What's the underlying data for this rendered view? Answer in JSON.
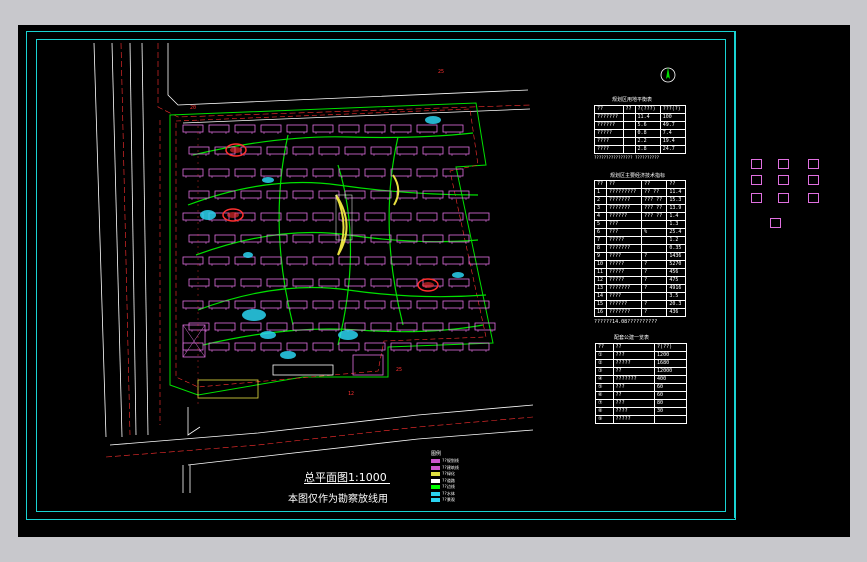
{
  "drawing": {
    "title": "总平面图1:1000",
    "note": "本图仅作为勘察放线用",
    "north_label": "北",
    "road_labels": [
      "25",
      "20",
      "12",
      "25"
    ]
  },
  "tables": [
    {
      "title": "规划区用地平衡表",
      "rows": [
        [
          "??",
          "??",
          "?(???)",
          "???(?)"
        ],
        [
          "???????",
          "",
          "11.4",
          "100"
        ],
        [
          "??????",
          "",
          "5.6",
          "49.7"
        ],
        [
          "?????",
          "",
          "0.8",
          "7.4"
        ],
        [
          "????",
          "",
          "2.2",
          "19.4"
        ],
        [
          "????",
          "",
          "2.8",
          "24.7"
        ]
      ],
      "footer": "???????????????? ??????????"
    },
    {
      "title": "规划区主要经济技术指标",
      "rows": [
        [
          "??",
          "??",
          "??",
          "??"
        ],
        [
          "1",
          "?????????",
          "?? ??",
          "11.4"
        ],
        [
          "2",
          "???????",
          "??? ??",
          "15.3"
        ],
        [
          "3",
          "???????",
          "??? ??",
          "13.9"
        ],
        [
          "4",
          "??????",
          "??? ??",
          "1.4"
        ],
        [
          "5",
          "???",
          "",
          "1.3"
        ],
        [
          "6",
          "???",
          "%",
          "25.4"
        ],
        [
          "7",
          "?????",
          "",
          "1.2"
        ],
        [
          "8",
          "???????",
          "",
          "0.35"
        ],
        [
          "9",
          "????",
          "?",
          "1436"
        ],
        [
          "10",
          "?????",
          "?",
          "5270"
        ],
        [
          "11",
          "?????",
          "?",
          "456"
        ],
        [
          "12",
          "?????",
          "?",
          "475"
        ],
        [
          "13",
          "???????",
          "?",
          "4916"
        ],
        [
          "14",
          "????",
          "",
          "3.5"
        ],
        [
          "15",
          "??????",
          "?",
          "20.3"
        ],
        [
          "16",
          "???????",
          "?",
          "436"
        ]
      ],
      "footer": "??????14.08??????????"
    },
    {
      "title": "配套公建一览表",
      "rows": [
        [
          "??",
          "??",
          "?(??)"
        ],
        [
          "①",
          "???",
          "1200"
        ],
        [
          "②",
          "?????",
          "1680"
        ],
        [
          "③",
          "??",
          "12000"
        ],
        [
          "④",
          "???????",
          "400"
        ],
        [
          "⑤",
          "???",
          "60"
        ],
        [
          "⑥",
          "??",
          "60"
        ],
        [
          "⑦",
          "???",
          "80"
        ],
        [
          "⑧",
          "????",
          "30"
        ],
        [
          "⑨",
          "?????",
          ""
        ]
      ]
    }
  ],
  "legend": {
    "title": "图例",
    "items": [
      {
        "label": "??规划线",
        "color": "#cc55cc"
      },
      {
        "label": "??建筑线",
        "color": "#cc55cc"
      },
      {
        "label": "??绿化",
        "color": "#e0e040"
      },
      {
        "label": "??道路",
        "color": "#ffffff"
      },
      {
        "label": "??边线",
        "color": "#00ff00"
      },
      {
        "label": "??水体",
        "color": "#2ad3f0"
      },
      {
        "label": "??景观",
        "color": "#2ad3f0"
      }
    ]
  },
  "colors": {
    "background": "#000000",
    "frame": "#19d3d3",
    "building": "#e070e0",
    "green_line": "#00e000",
    "road": "#ffffff",
    "water": "#2ad3f0",
    "axis": "#ff3030",
    "yellow": "#e8e040"
  },
  "palette_icons": [
    "house-icon",
    "house-icon",
    "house-icon",
    "house-icon",
    "house-icon",
    "house-icon",
    "house-icon",
    "house-icon",
    "house-icon",
    "house-icon",
    "house-icon"
  ]
}
